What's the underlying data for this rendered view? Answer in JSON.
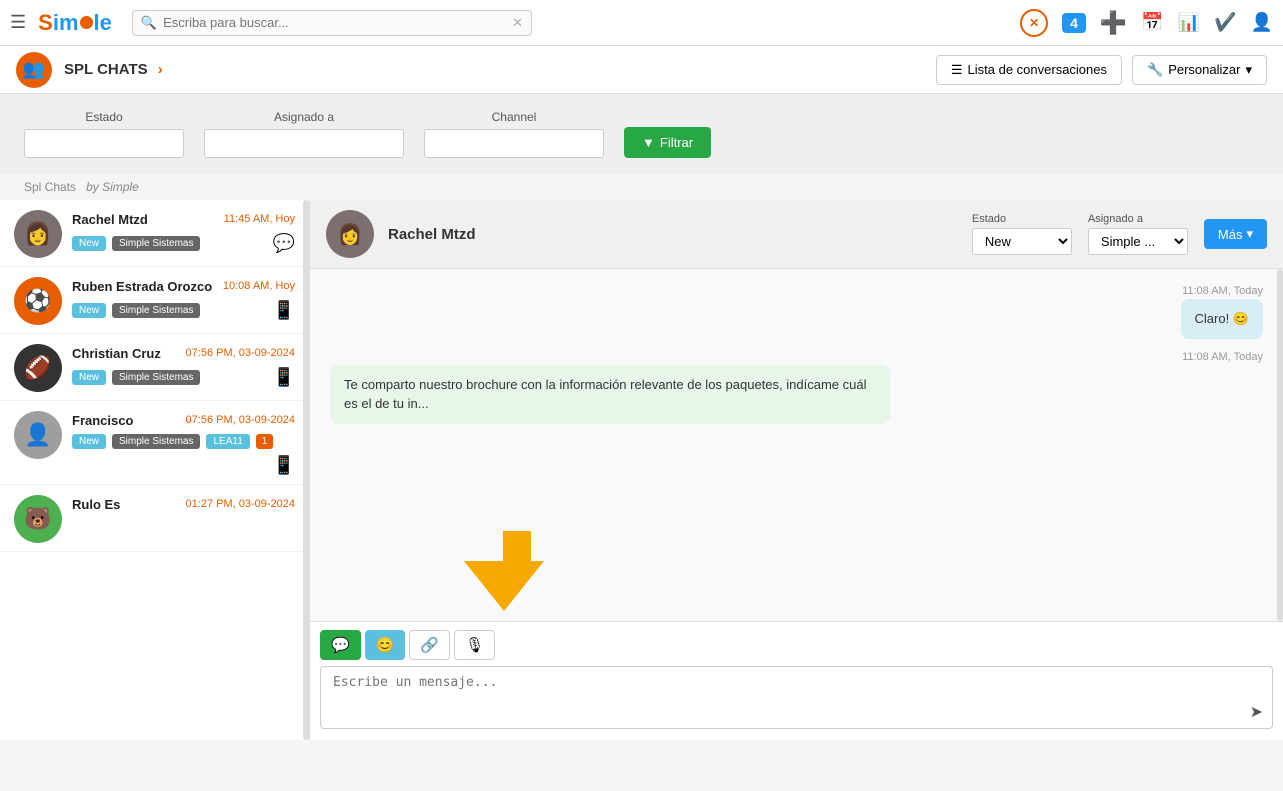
{
  "app": {
    "title": "Simple",
    "logo_text": "Simle",
    "hamburger": "☰"
  },
  "search": {
    "placeholder": "Escriba para buscar...",
    "value": ""
  },
  "top_icons": [
    {
      "name": "close-x-icon",
      "symbol": "✕",
      "color": "#e85d00"
    },
    {
      "name": "badge-4-icon",
      "symbol": "4",
      "color": "#2196f3",
      "badge": true
    },
    {
      "name": "plus-icon",
      "symbol": "+",
      "color": "#555"
    },
    {
      "name": "calendar-icon",
      "symbol": "📅",
      "color": "#555"
    },
    {
      "name": "chart-icon",
      "symbol": "📊",
      "color": "#555"
    },
    {
      "name": "check-icon",
      "symbol": "✔",
      "color": "#555"
    },
    {
      "name": "user-icon",
      "symbol": "👤",
      "color": "#555"
    }
  ],
  "sub_nav": {
    "title": "SPL CHATS",
    "chevron": "›",
    "list_conv_btn": "Lista de conversaciones",
    "customize_btn": "Personalizar"
  },
  "filters": {
    "estado_label": "Estado",
    "asignado_label": "Asignado a",
    "channel_label": "Channel",
    "filter_btn": "Filtrar",
    "credit_spl": "Spl Chats",
    "credit_by": "by Simple"
  },
  "chat_list": [
    {
      "id": 1,
      "name": "Rachel Mtzd",
      "time": "11:45 AM, Hoy",
      "tags": [
        "New",
        "Simple Sistemas"
      ],
      "channel": "messenger",
      "avatar_emoji": "👩"
    },
    {
      "id": 2,
      "name": "Ruben Estrada Orozco",
      "time": "10:08 AM, Hoy",
      "tags": [
        "New",
        "Simple Sistemas"
      ],
      "channel": "whatsapp",
      "avatar_emoji": "⚽"
    },
    {
      "id": 3,
      "name": "Christian Cruz",
      "time": "07:56 PM, 03-09-2024",
      "tags": [
        "New",
        "Simple Sistemas"
      ],
      "channel": "whatsapp",
      "avatar_emoji": "🏈"
    },
    {
      "id": 4,
      "name": "Francisco",
      "time": "07:56 PM, 03-09-2024",
      "tags": [
        "New",
        "Simple Sistemas",
        "LEA11",
        "1"
      ],
      "channel": "whatsapp",
      "avatar_emoji": "👤"
    },
    {
      "id": 5,
      "name": "Rulo Es",
      "time": "01:27 PM, 03-09-2024",
      "tags": [],
      "channel": "",
      "avatar_emoji": "🐻"
    }
  ],
  "chat_window": {
    "contact_name": "Rachel Mtzd",
    "avatar_emoji": "👩",
    "estado_label": "Estado",
    "asignado_label": "Asignado a",
    "estado_value": "New",
    "asignado_value": "Simple ...",
    "more_btn": "Más",
    "messages": [
      {
        "id": 1,
        "timestamp": "11:08 AM, Today",
        "text": "Claro! 😊",
        "type": "outgoing"
      },
      {
        "id": 2,
        "timestamp": "11:08 AM, Today",
        "text": "Te comparto nuestro brochure con la información relevante de los paquetes, indícame cuál es el de tu in...",
        "type": "incoming"
      }
    ],
    "input_placeholder": "Escribe un mensaje...",
    "toolbar": {
      "chat_btn": "💬",
      "emoji_btn": "😊",
      "attach_btn": "🔗",
      "mic_btn": "🎙"
    }
  }
}
